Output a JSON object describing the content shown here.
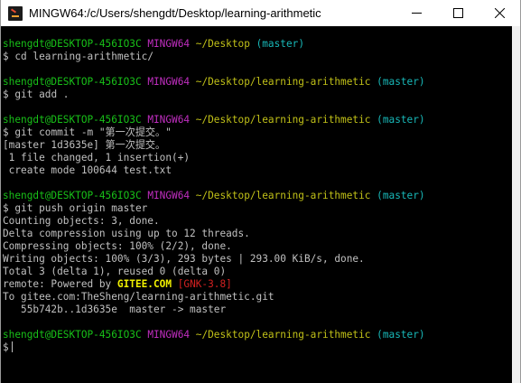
{
  "window": {
    "title": "MINGW64:/c/Users/shengdt/Desktop/learning-arithmetic"
  },
  "controls": {
    "minimize": "minimize-icon",
    "maximize": "maximize-icon",
    "close": "close-icon"
  },
  "prompts": {
    "user_host": "shengdt@DESKTOP-456IO3C",
    "shell": "MINGW64",
    "branch": "(master)",
    "path_desktop": "~/Desktop",
    "path_repo": "~/Desktop/learning-arithmetic",
    "symbol": "$"
  },
  "commands": {
    "cd": "cd learning-arithmetic/",
    "add": "git add .",
    "commit": "git commit -m \"第一次提交。\"",
    "push": "git push origin master"
  },
  "output": {
    "commit_1": "[master 1d3635e] 第一次提交。",
    "commit_2": " 1 file changed, 1 insertion(+)",
    "commit_3": " create mode 100644 test.txt",
    "push_1": "Counting objects: 3, done.",
    "push_2": "Delta compression using up to 12 threads.",
    "push_3": "Compressing objects: 100% (2/2), done.",
    "push_4": "Writing objects: 100% (3/3), 293 bytes | 293.00 KiB/s, done.",
    "push_5": "Total 3 (delta 1), reused 0 (delta 0)",
    "remote_prefix": "remote: Powered by ",
    "remote_gitee": "GITEE.COM",
    "remote_tag": "[GNK-3.8]",
    "push_to": "To gitee.com:TheSheng/learning-arithmetic.git",
    "push_ref": "   55b742b..1d3635e  master -> master"
  },
  "colors": {
    "user_host": "#18c018",
    "shell": "#c02ec0",
    "path": "#c0c018",
    "branch": "#18b8b8",
    "text": "#c0c0c0",
    "background": "#000000"
  }
}
